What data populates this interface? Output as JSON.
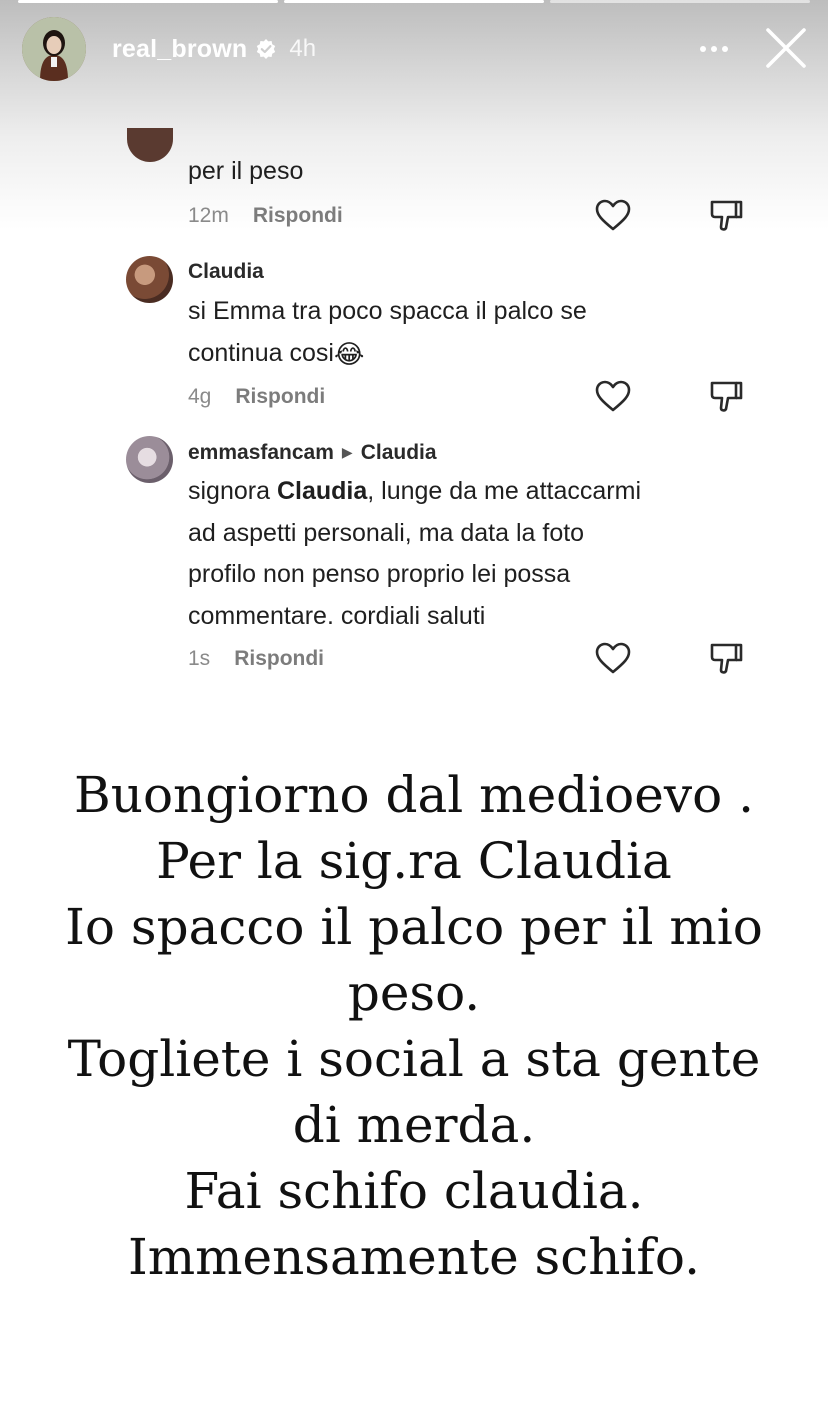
{
  "story": {
    "username": "real_brown",
    "time": "4h",
    "progress_segments": 3,
    "progress_done": 2
  },
  "comments": {
    "c0": {
      "text": "per il peso",
      "time": "12m",
      "reply": "Rispondi"
    },
    "c1": {
      "user": "Claudia",
      "text_line1": "si Emma tra poco spacca il palco se",
      "text_line2": "continua cosi",
      "emoji": "😂",
      "time": "4g",
      "reply": "Rispondi"
    },
    "c2": {
      "user": "emmasfancam",
      "reply_to": "Claudia",
      "text_prefix": "signora ",
      "text_mention": "Claudia",
      "text_line1_rest": ", lunge da me attaccarmi",
      "text_line2": "ad aspetti personali, ma data la foto",
      "text_line3": "profilo non penso proprio lei possa",
      "text_line4": "commentare. cordiali saluti",
      "time": "1s",
      "reply": "Rispondi"
    }
  },
  "caption": {
    "lines": [
      "Buongiorno dal medioevo .",
      "Per la sig.ra Claudia",
      "Io spacco il palco per il mio",
      "peso.",
      "Togliete i social a sta gente",
      "di merda.",
      "Fai schifo claudia.",
      "Immensamente schifo."
    ]
  }
}
